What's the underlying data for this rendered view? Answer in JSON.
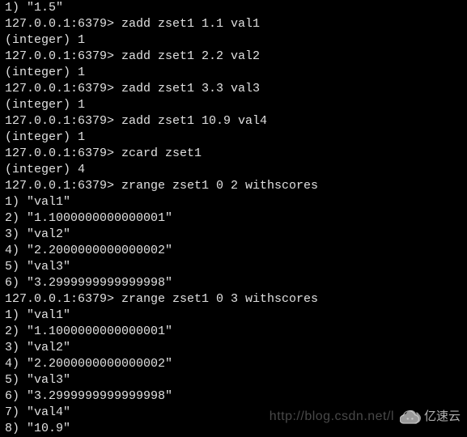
{
  "lines": [
    "1) \"1.5\"",
    "127.0.0.1:6379> zadd zset1 1.1 val1",
    "(integer) 1",
    "127.0.0.1:6379> zadd zset1 2.2 val2",
    "(integer) 1",
    "127.0.0.1:6379> zadd zset1 3.3 val3",
    "(integer) 1",
    "127.0.0.1:6379> zadd zset1 10.9 val4",
    "(integer) 1",
    "127.0.0.1:6379> zcard zset1",
    "(integer) 4",
    "127.0.0.1:6379> zrange zset1 0 2 withscores",
    "1) \"val1\"",
    "2) \"1.1000000000000001\"",
    "3) \"val2\"",
    "4) \"2.2000000000000002\"",
    "5) \"val3\"",
    "6) \"3.2999999999999998\"",
    "127.0.0.1:6379> zrange zset1 0 3 withscores",
    "1) \"val1\"",
    "2) \"1.1000000000000001\"",
    "3) \"val2\"",
    "4) \"2.2000000000000002\"",
    "5) \"val3\"",
    "6) \"3.2999999999999998\"",
    "7) \"val4\"",
    "8) \"10.9\""
  ],
  "watermark": "http://blog.csdn.net/l",
  "logo_text": "亿速云"
}
